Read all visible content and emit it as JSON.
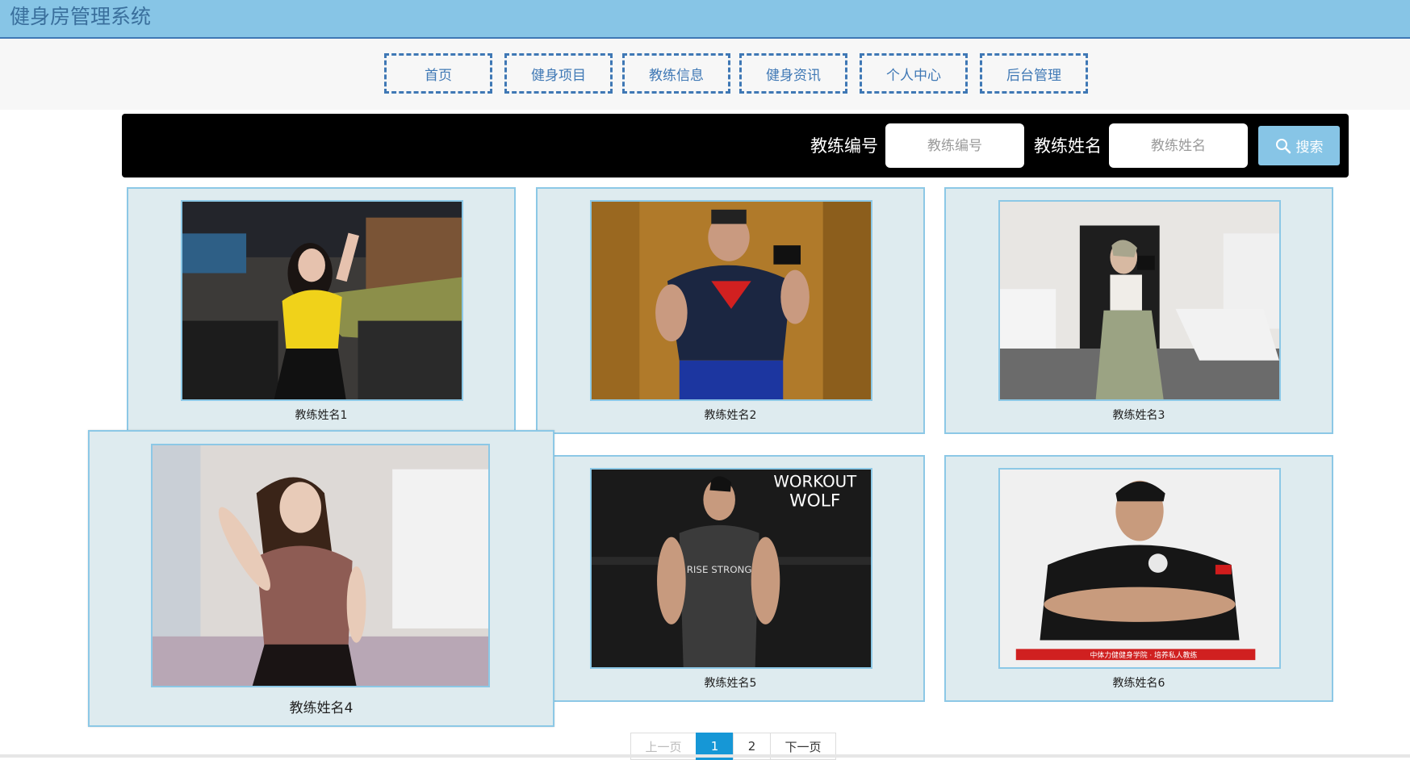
{
  "header": {
    "title": "健身房管理系统"
  },
  "nav": [
    {
      "label": "首页"
    },
    {
      "label": "健身项目"
    },
    {
      "label": "教练信息"
    },
    {
      "label": "健身资讯"
    },
    {
      "label": "个人中心"
    },
    {
      "label": "后台管理"
    }
  ],
  "search": {
    "field1_label": "教练编号",
    "field1_placeholder": "教练编号",
    "field2_label": "教练姓名",
    "field2_placeholder": "教练姓名",
    "button_label": "搜索"
  },
  "coaches": [
    {
      "name": "教练姓名1"
    },
    {
      "name": "教练姓名2"
    },
    {
      "name": "教练姓名3"
    },
    {
      "name": "教练姓名4"
    },
    {
      "name": "教练姓名5"
    },
    {
      "name": "教练姓名6"
    }
  ],
  "photo_text": {
    "coach5_line1": "WORKOUT",
    "coach5_line2": "WOLF",
    "coach5_shirt": "RISE STRONG",
    "coach6_banner": "中体力健健身学院 · 培养私人教练"
  },
  "pagination": {
    "prev": "上一页",
    "pages": [
      "1",
      "2"
    ],
    "current": "1",
    "next": "下一页"
  },
  "colors": {
    "header_bg": "#87c5e6",
    "accent": "#3f78b5",
    "card_bg": "#deebef",
    "active_page": "#1697d6"
  }
}
